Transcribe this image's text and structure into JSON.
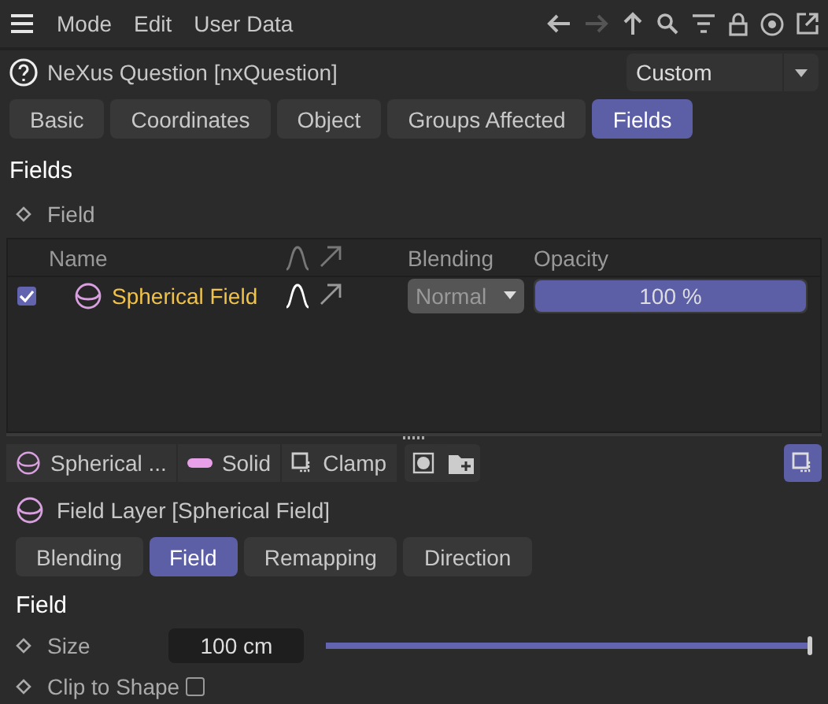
{
  "menu": {
    "items": [
      "Mode",
      "Edit",
      "User Data"
    ]
  },
  "object": {
    "title": "NeXus Question [nxQuestion]",
    "preset": "Custom"
  },
  "tabs": [
    {
      "label": "Basic",
      "selected": false
    },
    {
      "label": "Coordinates",
      "selected": false
    },
    {
      "label": "Object",
      "selected": false
    },
    {
      "label": "Groups Affected",
      "selected": false
    },
    {
      "label": "Fields",
      "selected": true
    }
  ],
  "section_title": "Fields",
  "field_param": {
    "label": "Field"
  },
  "table": {
    "columns": [
      "Name",
      "Blending",
      "Opacity"
    ],
    "rows": [
      {
        "checked": true,
        "name": "Spherical Field",
        "blending": "Normal",
        "opacity": "100 %",
        "level": 1
      }
    ]
  },
  "layer_toolbar": [
    {
      "kind": "sphere",
      "label": "Spherical ..."
    },
    {
      "kind": "solid",
      "label": "Solid"
    },
    {
      "kind": "clamp",
      "label": "Clamp"
    }
  ],
  "layer": {
    "title": "Field Layer [Spherical Field]"
  },
  "sub_tabs": [
    {
      "label": "Blending",
      "selected": false
    },
    {
      "label": "Field",
      "selected": true
    },
    {
      "label": "Remapping",
      "selected": false
    },
    {
      "label": "Direction",
      "selected": false
    }
  ],
  "group_title": "Field",
  "params": [
    {
      "kind": "slider",
      "label": "Size",
      "value": "100 cm",
      "level": 1
    },
    {
      "kind": "checkbox",
      "label": "Clip to Shape",
      "checked": false
    }
  ]
}
